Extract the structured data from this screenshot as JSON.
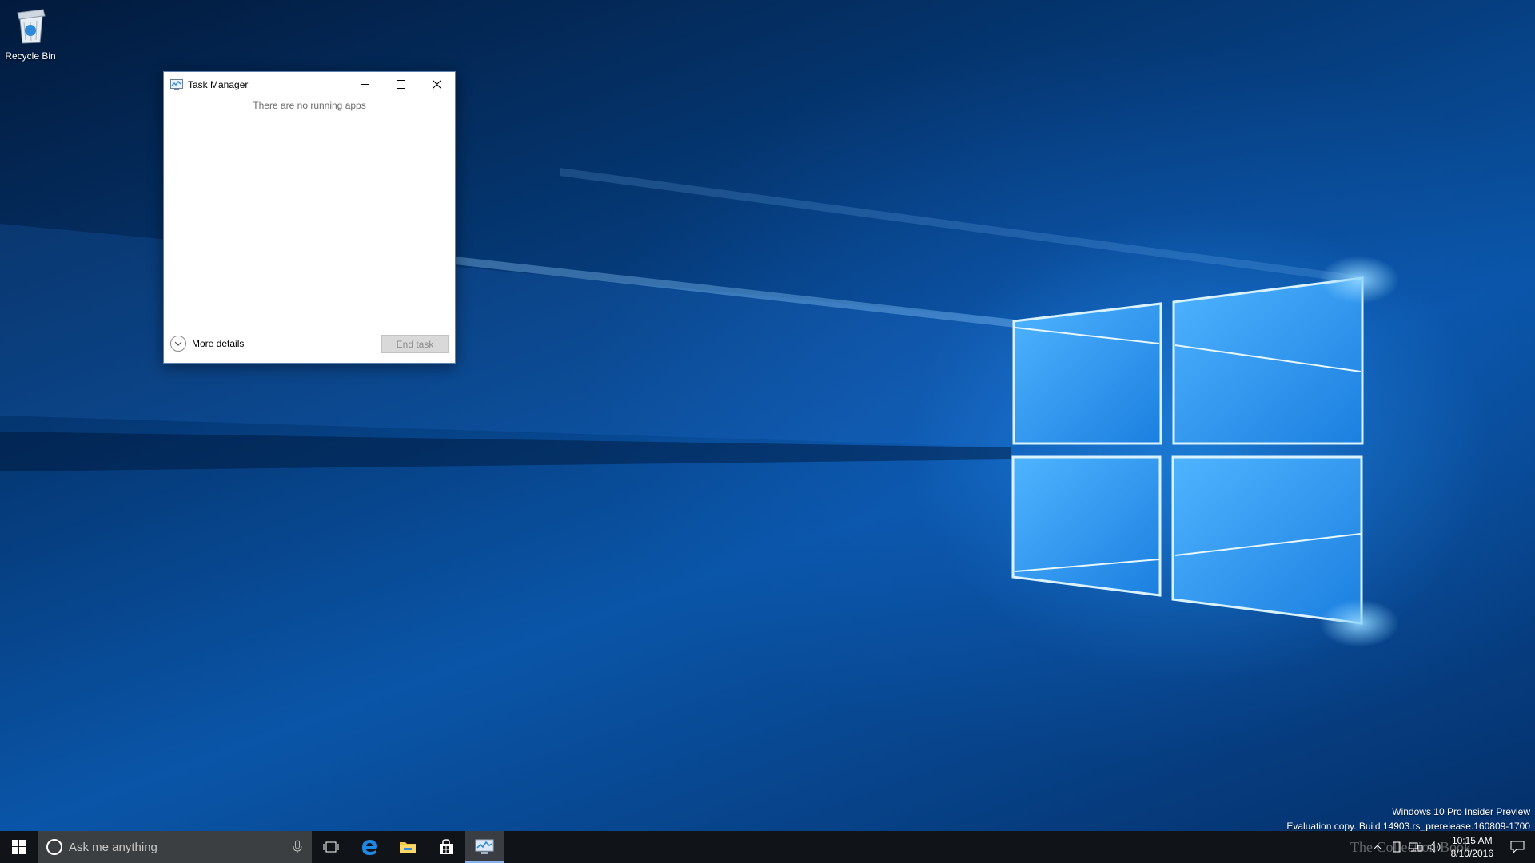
{
  "desktop": {
    "icons": [
      {
        "label": "Recycle Bin",
        "icon": "recycle-bin-icon"
      }
    ]
  },
  "window": {
    "title": "Task Manager",
    "icon": "task-manager-icon",
    "empty_message": "There are no running apps",
    "more_details_label": "More details",
    "end_task_label": "End task",
    "controls": [
      "minimize",
      "maximize",
      "close"
    ]
  },
  "watermark": {
    "line1": "Windows 10 Pro Insider Preview",
    "line2": "Evaluation copy. Build 14903.rs_prerelease.160809-1700"
  },
  "taskbar": {
    "search_placeholder": "Ask me anything",
    "pinned": [
      {
        "name": "task-view",
        "icon": "task-view-icon"
      },
      {
        "name": "edge",
        "icon": "edge-icon"
      },
      {
        "name": "file-explorer",
        "icon": "folder-icon"
      },
      {
        "name": "store",
        "icon": "store-icon"
      },
      {
        "name": "task-manager",
        "icon": "task-manager-icon",
        "active": true
      }
    ],
    "time": "10:15 AM",
    "date": "8/10/2016",
    "overlay_text": "The Collection Book"
  },
  "colors": {
    "taskbar": "#101418",
    "search_box": "#3c3f42",
    "accent": "#0a55a8"
  }
}
